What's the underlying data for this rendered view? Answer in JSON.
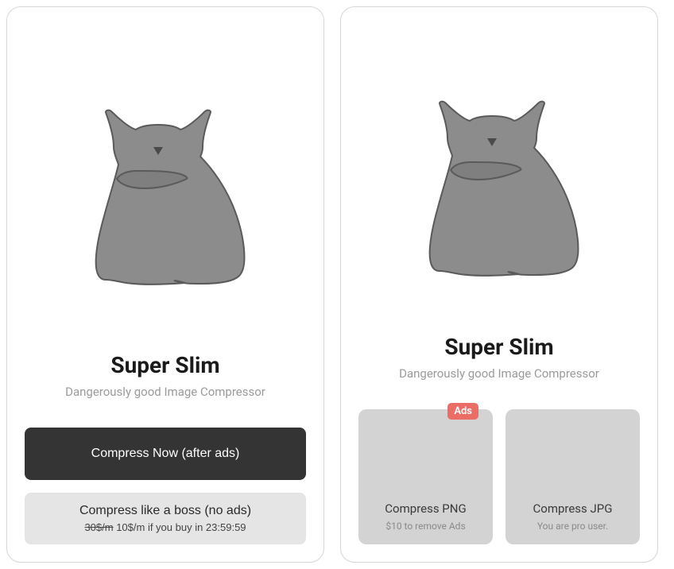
{
  "screens": [
    {
      "title": "Super Slim",
      "subtitle": "Dangerously good Image Compressor",
      "primary_button": "Compress Now (after ads)",
      "secondary_button": {
        "label": "Compress like a boss (no ads)",
        "strike_price": "30$/m",
        "offer_text_after": " 10$/m if you buy in 23:59:59"
      }
    },
    {
      "title": "Super Slim",
      "subtitle": "Dangerously good Image Compressor",
      "ads_badge": "Ads",
      "card1": {
        "title": "Compress PNG",
        "sub": "$10 to remove Ads"
      },
      "card2": {
        "title": "Compress JPG",
        "sub": "You are pro user."
      }
    }
  ]
}
